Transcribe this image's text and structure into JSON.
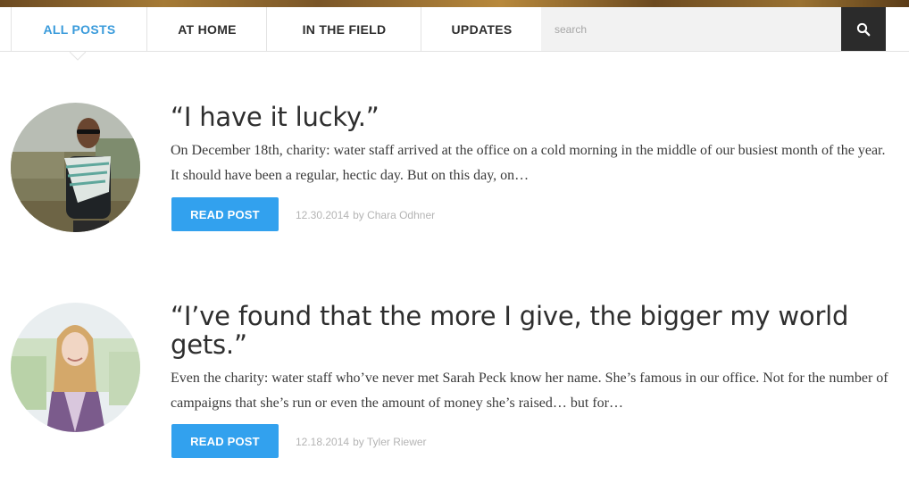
{
  "nav": {
    "tabs": [
      {
        "label": "ALL POSTS",
        "active": true
      },
      {
        "label": "AT HOME",
        "active": false
      },
      {
        "label": "IN THE FIELD",
        "active": false
      },
      {
        "label": "UPDATES",
        "active": false
      }
    ],
    "search": {
      "placeholder": "search",
      "value": ""
    },
    "search_icon": "search-icon"
  },
  "posts": [
    {
      "title": "“I have it lucky.”",
      "excerpt": "On December 18th, charity: water staff arrived at the office on a cold morning in the middle of our busiest month of the year. It should have been a regular, hectic day. But on this day, on…",
      "button_label": "READ POST",
      "date": "12.30.2014",
      "byline": "by Chara Odhner"
    },
    {
      "title": "“I’ve found that the more I give, the bigger my world gets.”",
      "excerpt": "Even the charity: water staff who’ve never met Sarah Peck know her name. She’s famous in our office. Not for the number of campaigns that she’s run or even the amount of money she’s raised… but for…",
      "button_label": "READ POST",
      "date": "12.18.2014",
      "byline": "by Tyler Riewer"
    }
  ],
  "colors": {
    "accent": "#32a1ee",
    "active_tab": "#3a9bdb",
    "search_button": "#2b2b2b"
  }
}
